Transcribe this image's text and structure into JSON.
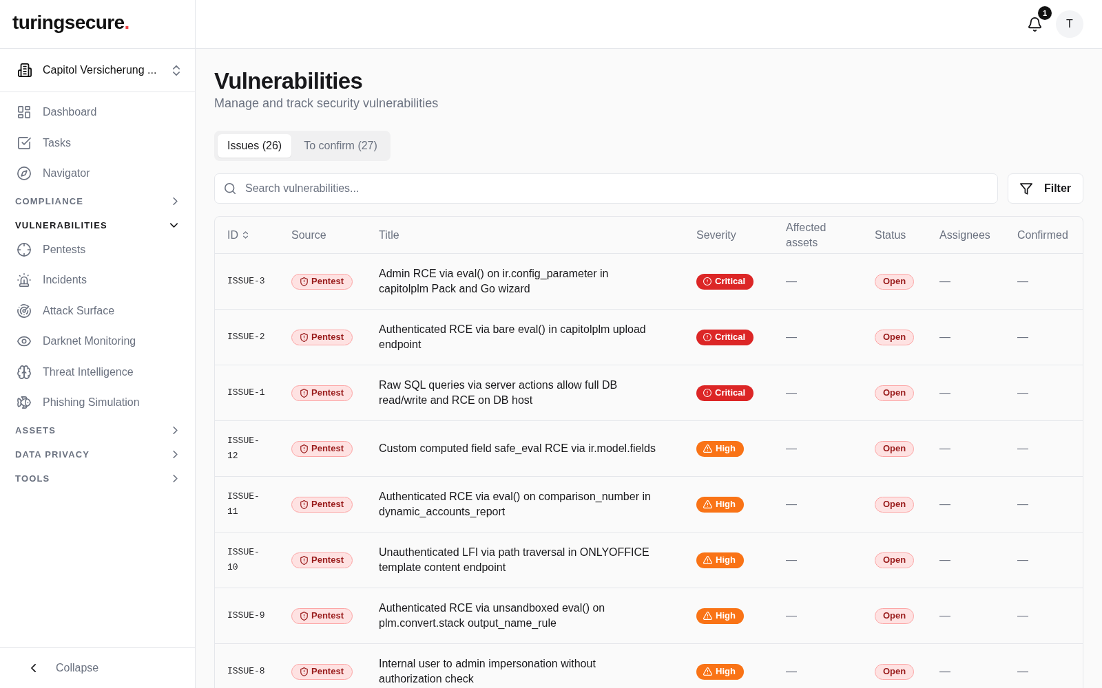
{
  "logo": {
    "wordmark": "turingsecure",
    "dot": "."
  },
  "org_switcher": {
    "label": "Capitol Versicherung ..."
  },
  "sidebar": {
    "items": [
      {
        "kind": "link",
        "label": "Dashboard"
      },
      {
        "kind": "link",
        "label": "Tasks"
      },
      {
        "kind": "link",
        "label": "Navigator"
      },
      {
        "kind": "section",
        "label": "COMPLIANCE",
        "expanded": false
      },
      {
        "kind": "section",
        "label": "VULNERABILITIES",
        "expanded": true,
        "children": [
          {
            "label": "Pentests"
          },
          {
            "label": "Incidents"
          },
          {
            "label": "Attack Surface"
          },
          {
            "label": "Darknet Monitoring"
          },
          {
            "label": "Threat Intelligence"
          },
          {
            "label": "Phishing Simulation"
          }
        ]
      },
      {
        "kind": "section",
        "label": "ASSETS",
        "expanded": false
      },
      {
        "kind": "section",
        "label": "DATA PRIVACY",
        "expanded": false
      },
      {
        "kind": "section",
        "label": "TOOLS",
        "expanded": false
      }
    ],
    "collapse": {
      "label": "Collapse"
    }
  },
  "top_bar": {
    "notifications": {
      "count": "1"
    },
    "avatar": {
      "initial": "T"
    }
  },
  "page": {
    "title": "Vulnerabilities",
    "subtitle": "Manage and track security vulnerabilities"
  },
  "tabs": [
    {
      "label": "Issues (26)",
      "selected": true
    },
    {
      "label": "To confirm (27)",
      "selected": false
    }
  ],
  "search": {
    "placeholder": "Search vulnerabilities..."
  },
  "filter_button": {
    "label": "Filter"
  },
  "table": {
    "columns": [
      {
        "label": "ID",
        "sortable": true
      },
      {
        "label": "Source",
        "sortable": false
      },
      {
        "label": "Title",
        "sortable": false
      },
      {
        "label": "Severity",
        "sortable": false
      },
      {
        "label": "Affected assets",
        "sortable": false
      },
      {
        "label": "Status",
        "sortable": false
      },
      {
        "label": "Assignees",
        "sortable": false
      },
      {
        "label": "Confirmed",
        "sortable": false
      }
    ],
    "rows": [
      {
        "id": "ISSUE-3",
        "source": "Pentest",
        "title": "Admin RCE via eval() on ir.config_parameter in capitolplm Pack and Go wizard",
        "severity": {
          "kind": "critical",
          "label": "Critical"
        },
        "affected_assets": "—",
        "status": "Open",
        "assignees": "—",
        "confirmed": "—"
      },
      {
        "id": "ISSUE-2",
        "source": "Pentest",
        "title": "Authenticated RCE via bare eval() in capitolplm upload endpoint",
        "severity": {
          "kind": "critical",
          "label": "Critical"
        },
        "affected_assets": "—",
        "status": "Open",
        "assignees": "—",
        "confirmed": "—"
      },
      {
        "id": "ISSUE-1",
        "source": "Pentest",
        "title": "Raw SQL queries via server actions allow full DB read/write and RCE on DB host",
        "severity": {
          "kind": "critical",
          "label": "Critical"
        },
        "affected_assets": "—",
        "status": "Open",
        "assignees": "—",
        "confirmed": "—"
      },
      {
        "id": "ISSUE-12",
        "source": "Pentest",
        "title": "Custom computed field safe_eval RCE via ir.model.fields",
        "severity": {
          "kind": "high",
          "label": "High"
        },
        "affected_assets": "—",
        "status": "Open",
        "assignees": "—",
        "confirmed": "—"
      },
      {
        "id": "ISSUE-11",
        "source": "Pentest",
        "title": "Authenticated RCE via eval() on comparison_number in dynamic_accounts_report",
        "severity": {
          "kind": "high",
          "label": "High"
        },
        "affected_assets": "—",
        "status": "Open",
        "assignees": "—",
        "confirmed": "—"
      },
      {
        "id": "ISSUE-10",
        "source": "Pentest",
        "title": "Unauthenticated LFI via path traversal in ONLYOFFICE template content endpoint",
        "severity": {
          "kind": "high",
          "label": "High"
        },
        "affected_assets": "—",
        "status": "Open",
        "assignees": "—",
        "confirmed": "—"
      },
      {
        "id": "ISSUE-9",
        "source": "Pentest",
        "title": "Authenticated RCE via unsandboxed eval() on plm.convert.stack output_name_rule",
        "severity": {
          "kind": "high",
          "label": "High"
        },
        "affected_assets": "—",
        "status": "Open",
        "assignees": "—",
        "confirmed": "—"
      },
      {
        "id": "ISSUE-8",
        "source": "Pentest",
        "title": "Internal user to admin impersonation without authorization check",
        "severity": {
          "kind": "high",
          "label": "High"
        },
        "affected_assets": "—",
        "status": "Open",
        "assignees": "—",
        "confirmed": "—"
      }
    ]
  }
}
